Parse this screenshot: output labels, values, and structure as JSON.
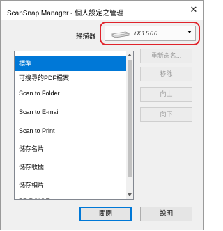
{
  "window": {
    "title": "ScanSnap Manager - 個人設定之管理"
  },
  "scanner": {
    "label": "掃描器",
    "value": "iX1500"
  },
  "profiles": [
    "標準",
    "可搜尋的PDF檔案",
    "Scan to Folder",
    "Scan to E-mail",
    "Scan to Print",
    "儲存名片",
    "儲存收據",
    "儲存相片",
    "PF-ROULT"
  ],
  "selected_index": 0,
  "side_buttons": {
    "rename": "重新命名...",
    "delete": "移除",
    "up": "向上",
    "down": "向下"
  },
  "bottom_buttons": {
    "close": "關閉",
    "help": "說明"
  },
  "colors": {
    "selection": "#0078d7",
    "highlight_ring": "#e0232b"
  }
}
